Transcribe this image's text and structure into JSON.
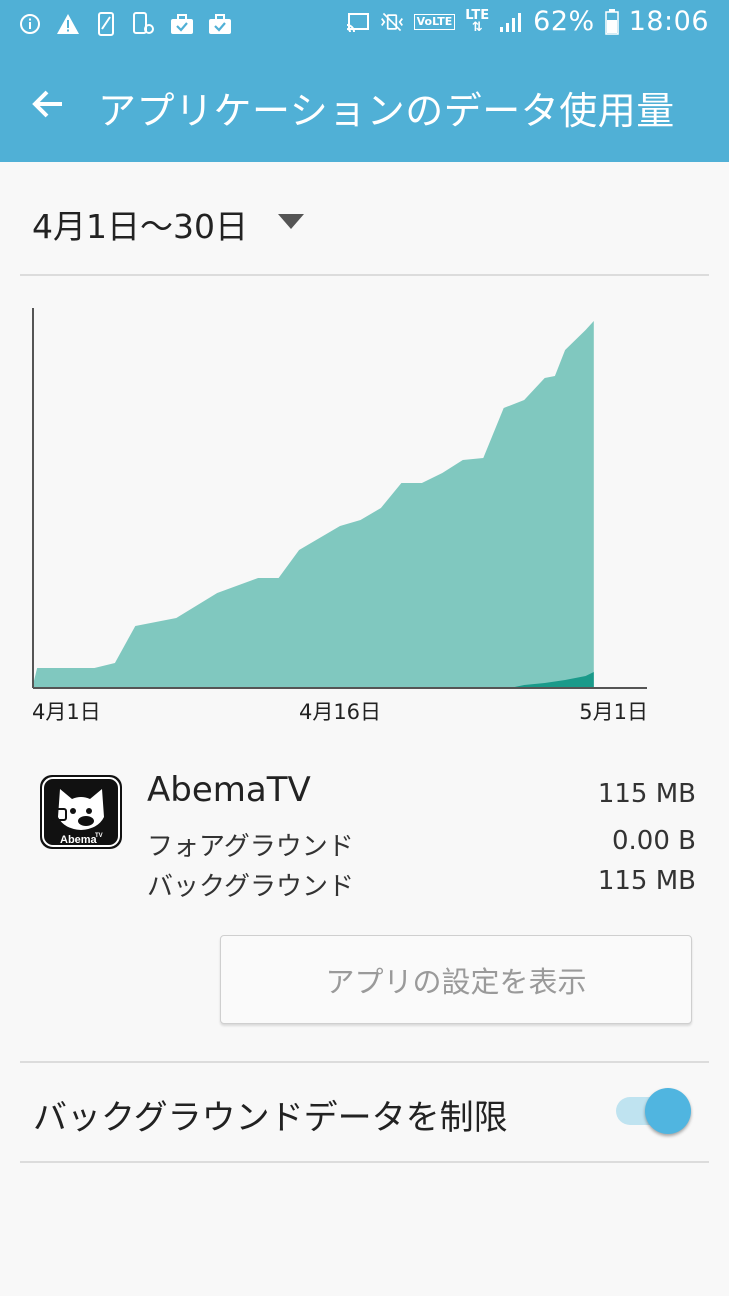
{
  "status_bar": {
    "battery": "62%",
    "time": "18:06",
    "volte": "VoLTE",
    "lte": "LTE",
    "icons_left": [
      "info-icon",
      "warning-icon",
      "phone-icon",
      "device-settings-icon",
      "briefcase-check-icon",
      "briefcase-check-icon"
    ],
    "icons_right": [
      "cast-icon",
      "vibrate-mute-icon",
      "volte-icon",
      "lte-icon",
      "signal-icon",
      "battery-icon"
    ]
  },
  "app_bar": {
    "title": "アプリケーションのデータ使用量",
    "back_icon": "arrow-back-icon",
    "color": "#50b0d6"
  },
  "date_range": {
    "label": "4月1日〜30日",
    "dropdown_icon": "triangle-down-icon"
  },
  "chart_data": {
    "type": "area",
    "x_tick_labels": [
      "4月1日",
      "4月16日",
      "5月1日"
    ],
    "x_range_days": [
      1,
      31
    ],
    "series": [
      {
        "color": "#80c8bf",
        "x": [
          1,
          1.2,
          4,
          5,
          6,
          8,
          10,
          12,
          13,
          14,
          16,
          17,
          18,
          19,
          20,
          21,
          22,
          23,
          24,
          25,
          26,
          26.5,
          27,
          28,
          28.4
        ],
        "y": [
          3,
          20,
          20,
          25,
          62,
          70,
          95,
          110,
          110,
          138,
          162,
          168,
          180,
          205,
          205,
          215,
          228,
          230,
          280,
          288,
          310,
          312,
          338,
          358,
          367
        ]
      },
      {
        "color": "#1a9a8a",
        "x": [
          1,
          24.3,
          25,
          26,
          27,
          28,
          28.4
        ],
        "y": [
          0,
          0,
          3,
          5,
          8,
          12,
          16
        ]
      }
    ]
  },
  "app": {
    "name": "AbemaTV",
    "total": "115 MB",
    "icon_name": "abematv-app-icon",
    "icon_text": "Abema",
    "icon_sup": "TV",
    "rows": [
      {
        "label": "フォアグラウンド",
        "value": "0.00 B"
      },
      {
        "label": "バックグラウンド",
        "value": "115 MB"
      }
    ]
  },
  "settings_button": {
    "label": "アプリの設定を表示"
  },
  "restrict_background": {
    "label": "バックグラウンドデータを制限",
    "enabled": true,
    "accent": "#50b5e0"
  }
}
